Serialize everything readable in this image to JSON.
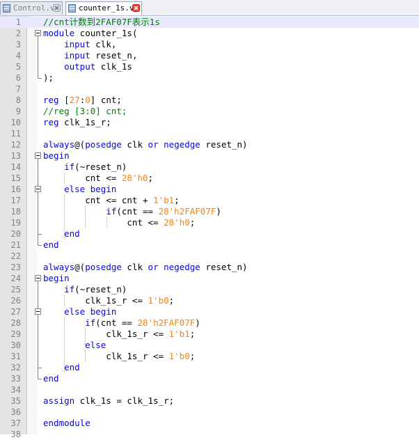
{
  "tabs": [
    {
      "label": "Control.v",
      "active": false
    },
    {
      "label": "counter_1s.v",
      "active": true
    }
  ],
  "colors": {
    "keyword": "#0000ff",
    "number": "#ff8000",
    "comment": "#008000"
  },
  "lines": [
    {
      "n": "1",
      "c": "//cnt计数到2FAF07F表示1s"
    },
    {
      "n": "2",
      "c": "module counter_1s("
    },
    {
      "n": "3",
      "c": "    input clk,"
    },
    {
      "n": "4",
      "c": "    input reset_n,"
    },
    {
      "n": "5",
      "c": "    output clk_1s"
    },
    {
      "n": "6",
      "c": ");"
    },
    {
      "n": "7",
      "c": ""
    },
    {
      "n": "8",
      "c": "reg [27:0] cnt;"
    },
    {
      "n": "9",
      "c": "//reg [3:0] cnt;"
    },
    {
      "n": "10",
      "c": "reg clk_1s_r;"
    },
    {
      "n": "11",
      "c": ""
    },
    {
      "n": "12",
      "c": "always@(posedge clk or negedge reset_n)"
    },
    {
      "n": "13",
      "c": "begin"
    },
    {
      "n": "14",
      "c": "    if(~reset_n)"
    },
    {
      "n": "15",
      "c": "        cnt <= 28'h0;"
    },
    {
      "n": "16",
      "c": "    else begin"
    },
    {
      "n": "17",
      "c": "        cnt <= cnt + 1'b1;"
    },
    {
      "n": "18",
      "c": "            if(cnt == 28'h2FAF07F)"
    },
    {
      "n": "19",
      "c": "                cnt <= 28'h0;"
    },
    {
      "n": "20",
      "c": "    end"
    },
    {
      "n": "21",
      "c": "end"
    },
    {
      "n": "22",
      "c": ""
    },
    {
      "n": "23",
      "c": "always@(posedge clk or negedge reset_n)"
    },
    {
      "n": "24",
      "c": "begin"
    },
    {
      "n": "25",
      "c": "    if(~reset_n)"
    },
    {
      "n": "26",
      "c": "        clk_1s_r <= 1'b0;"
    },
    {
      "n": "27",
      "c": "    else begin"
    },
    {
      "n": "28",
      "c": "        if(cnt == 28'h2FAF07F)"
    },
    {
      "n": "29",
      "c": "            clk_1s_r <= 1'b1;"
    },
    {
      "n": "30",
      "c": "        else"
    },
    {
      "n": "31",
      "c": "            clk_1s_r <= 1'b0;"
    },
    {
      "n": "32",
      "c": "    end"
    },
    {
      "n": "33",
      "c": "end"
    },
    {
      "n": "34",
      "c": ""
    },
    {
      "n": "35",
      "c": "assign clk_1s = clk_1s_r;"
    },
    {
      "n": "36",
      "c": ""
    },
    {
      "n": "37",
      "c": "endmodule"
    },
    {
      "n": "38",
      "c": ""
    }
  ]
}
